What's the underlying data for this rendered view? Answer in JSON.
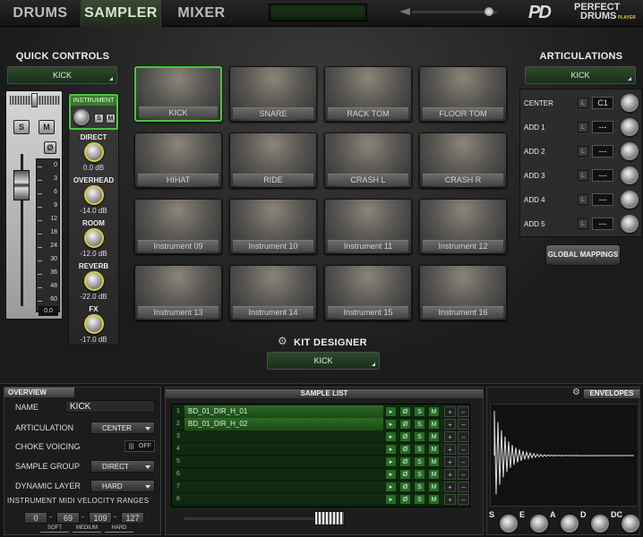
{
  "tabs": [
    {
      "label": "DRUMS"
    },
    {
      "label": "SAMPLER"
    },
    {
      "label": "MIXER"
    }
  ],
  "brand": {
    "line1": "PERFECT",
    "line2": "DRUMS",
    "line3": "PLAYER",
    "logo": "PD"
  },
  "volume_level": 0.9,
  "quick_controls": {
    "title": "QUICK CONTROLS",
    "selected": "KICK",
    "solo": "S",
    "mute": "M",
    "phase": "Ø",
    "scale": [
      "0",
      "3",
      "6",
      "9",
      "12",
      "18",
      "24",
      "30",
      "36",
      "48",
      "60"
    ],
    "readout": "0.0",
    "instrument": {
      "label": "INSTRUMENT",
      "s": "S",
      "m": "M"
    },
    "knobs": [
      {
        "label": "DIRECT",
        "value": "0.0 dB"
      },
      {
        "label": "OVERHEAD",
        "value": "-14.0 dB"
      },
      {
        "label": "ROOM",
        "value": "-12.0 dB"
      },
      {
        "label": "REVERB",
        "value": "-22.0 dB"
      },
      {
        "label": "FX",
        "value": "-17.0 dB"
      }
    ]
  },
  "pads": [
    "KICK",
    "SNARE",
    "RACK TOM",
    "FLOOR TOM",
    "HIHAT",
    "RIDE",
    "CRASH L",
    "CRASH R",
    "Instrument 09",
    "Instrument 10",
    "Instrument 11",
    "Instrument 12",
    "Instrument 13",
    "Instrument 14",
    "Instrument 15",
    "Instrument 16"
  ],
  "kit_designer": {
    "title": "KIT DESIGNER",
    "selected": "KICK"
  },
  "articulations": {
    "title": "ARTICULATIONS",
    "selected": "KICK",
    "rows": [
      {
        "label": "CENTER",
        "l": "L",
        "value": "C1"
      },
      {
        "label": "ADD 1",
        "l": "L",
        "value": "---"
      },
      {
        "label": "ADD 2",
        "l": "L",
        "value": "---"
      },
      {
        "label": "ADD 3",
        "l": "L",
        "value": "---"
      },
      {
        "label": "ADD 4",
        "l": "L",
        "value": "---"
      },
      {
        "label": "ADD 5",
        "l": "L",
        "value": "---"
      }
    ],
    "global_mappings": "GLOBAL MAPPINGS"
  },
  "overview": {
    "title": "OVERVIEW",
    "name_label": "NAME",
    "name_value": "KICK",
    "articulation_label": "ARTICULATION",
    "articulation_value": "CENTER",
    "choke_label": "CHOKE VOICING",
    "choke_value": "OFF",
    "group_label": "SAMPLE GROUP",
    "group_value": "DIRECT",
    "layer_label": "DYNAMIC LAYER",
    "layer_value": "HARD",
    "velocity_title": "INSTRUMENT  MIDI  VELOCITY  RANGES",
    "velocities": [
      "0",
      "69",
      "109",
      "127"
    ],
    "ranges": [
      "SOFT",
      "MEDIUM",
      "HARD"
    ]
  },
  "sample_list": {
    "title": "SAMPLE LIST",
    "rows": [
      {
        "num": "1",
        "name": "BD_01_DIR_H_01"
      },
      {
        "num": "2",
        "name": "BD_01_DIR_H_02"
      },
      {
        "num": "3",
        "name": ""
      },
      {
        "num": "4",
        "name": ""
      },
      {
        "num": "5",
        "name": ""
      },
      {
        "num": "6",
        "name": ""
      },
      {
        "num": "7",
        "name": ""
      },
      {
        "num": "8",
        "name": ""
      }
    ],
    "btns": {
      "play": "▸",
      "phase": "Ø",
      "s": "S",
      "m": "M",
      "plus": "+",
      "minus": "–"
    }
  },
  "envelopes": {
    "title": "ENVELOPES",
    "knobs": [
      "S",
      "E",
      "A",
      "D",
      "DC"
    ]
  }
}
